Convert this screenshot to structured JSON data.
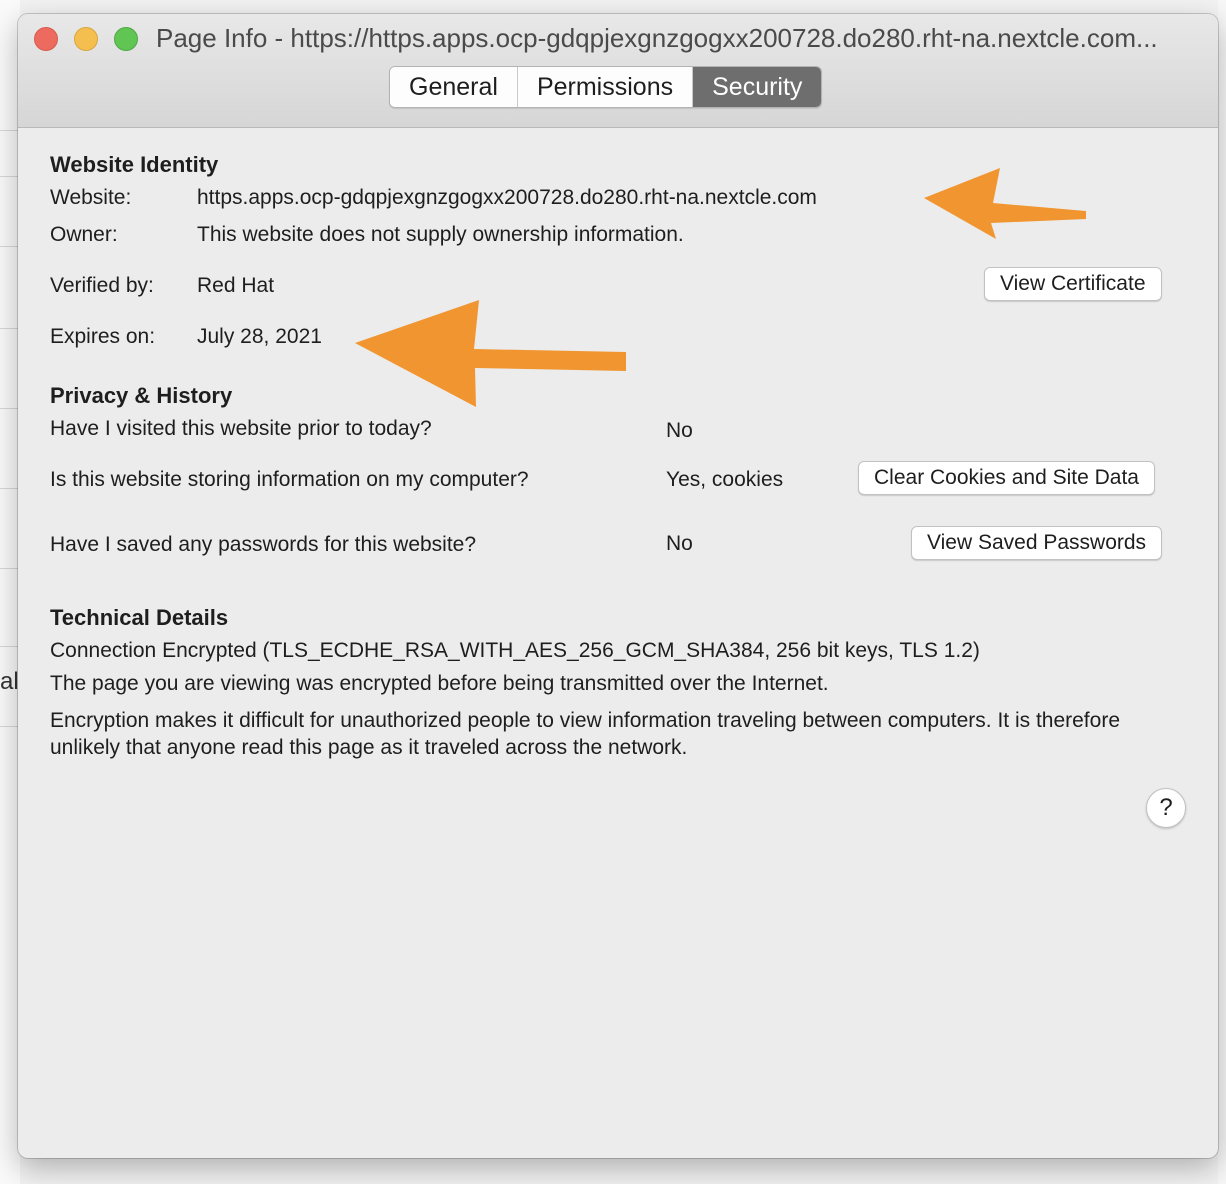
{
  "window": {
    "title": "Page Info - https://https.apps.ocp-gdqpjexgnzgogxx200728.do280.rht-na.nextcle.com..."
  },
  "background": {
    "partial_text": "al"
  },
  "tabs": [
    {
      "label": "General",
      "active": false
    },
    {
      "label": "Permissions",
      "active": false
    },
    {
      "label": "Security",
      "active": true
    }
  ],
  "identity": {
    "heading": "Website Identity",
    "website_label": "Website:",
    "website_value": "https.apps.ocp-gdqpjexgnzgogxx200728.do280.rht-na.nextcle.com",
    "owner_label": "Owner:",
    "owner_value": "This website does not supply ownership information.",
    "verified_label": "Verified by:",
    "verified_value": "Red Hat",
    "view_certificate": "View Certificate",
    "expires_label": "Expires on:",
    "expires_value": "July 28, 2021"
  },
  "privacy": {
    "heading": "Privacy & History",
    "visited_q": "Have I visited this website prior to today?",
    "visited_a": "No",
    "storing_q": "Is this website storing information on my computer?",
    "storing_a": "Yes, cookies",
    "clear_button": "Clear Cookies and Site Data",
    "passwords_q": "Have I saved any passwords for this website?",
    "passwords_a": "No",
    "passwords_button": "View Saved Passwords"
  },
  "technical": {
    "heading": "Technical Details",
    "line1": "Connection Encrypted (TLS_ECDHE_RSA_WITH_AES_256_GCM_SHA384, 256 bit keys, TLS 1.2)",
    "line2": "The page you are viewing was encrypted before being transmitted over the Internet.",
    "line3": "Encryption makes it difficult for unauthorized people to view information traveling between computers. It is therefore unlikely that anyone read this page as it traveled across the network."
  },
  "help": {
    "label": "?"
  },
  "colors": {
    "annotation_arrow": "#f0952f",
    "active_tab": "#6e6e6e"
  }
}
